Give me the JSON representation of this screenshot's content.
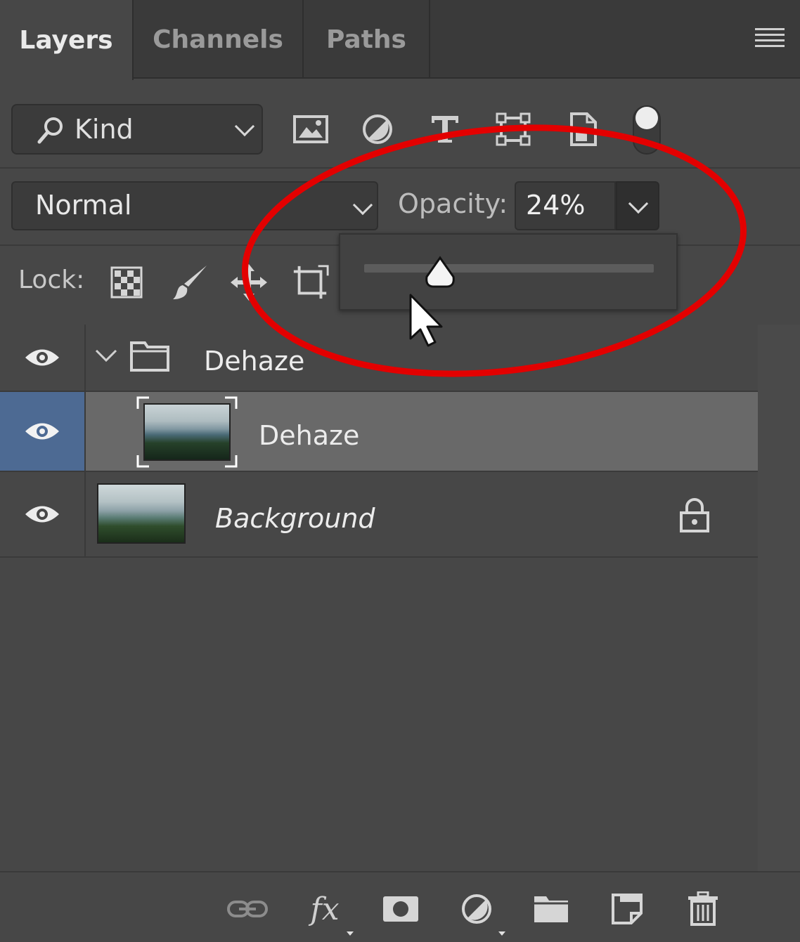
{
  "tabs": [
    {
      "label": "Layers",
      "active": true
    },
    {
      "label": "Channels",
      "active": false
    },
    {
      "label": "Paths",
      "active": false
    }
  ],
  "filter": {
    "kind_label": "Kind",
    "icons": [
      "image-filter-icon",
      "adjustment-filter-icon",
      "type-filter-icon",
      "shape-filter-icon",
      "smart-object-filter-icon",
      "filter-toggle-switch"
    ]
  },
  "blend": {
    "mode": "Normal",
    "opacity_label": "Opacity:",
    "opacity_value": "24%",
    "opacity_fraction": 0.24
  },
  "lock": {
    "label": "Lock:",
    "icons": [
      "lock-transparent-pixels-icon",
      "lock-image-pixels-icon",
      "lock-position-icon",
      "lock-artboard-icon"
    ]
  },
  "layers": [
    {
      "name": "Dehaze",
      "type": "group",
      "expanded": true,
      "visible": true,
      "selected": false
    },
    {
      "name": "Dehaze",
      "type": "smart-object",
      "visible": true,
      "selected": true
    },
    {
      "name": "Background",
      "type": "background",
      "visible": true,
      "selected": false,
      "locked": true
    }
  ],
  "bottom_bar": {
    "icons": [
      "link-layers-icon",
      "fx-icon",
      "add-mask-icon",
      "new-adjustment-icon",
      "new-group-icon",
      "new-layer-icon",
      "delete-layer-icon"
    ],
    "fx_label": "fx"
  },
  "colors": {
    "panel": "#474747",
    "selected_row": "#696969",
    "selected_eye": "#4d6a93",
    "annotation": "#e30000"
  }
}
